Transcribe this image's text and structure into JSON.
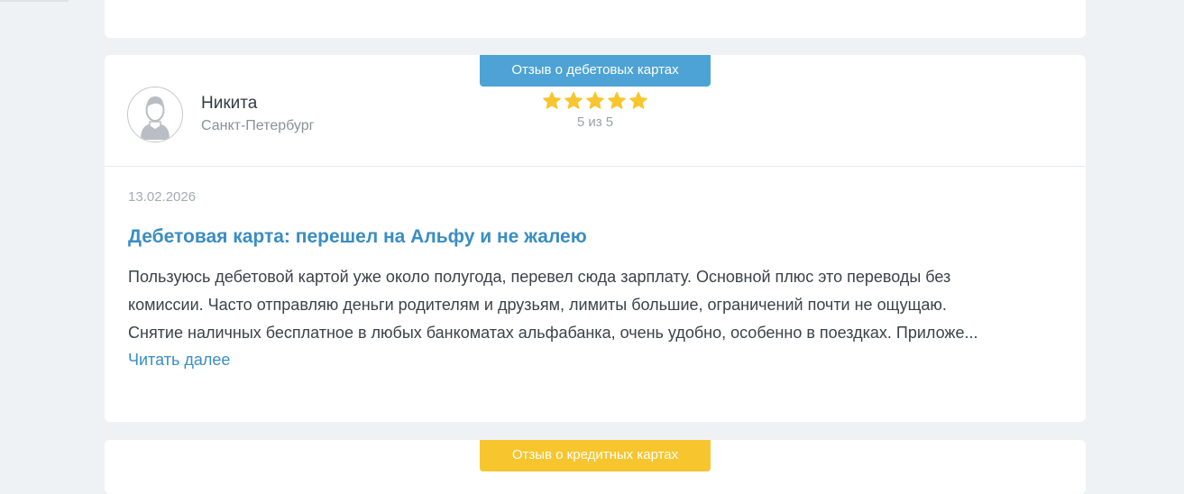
{
  "reviews": [
    {
      "badge": "Отзыв о дебетовых картах",
      "badge_color": "#4da3d6",
      "author_name": "Никита",
      "author_city": "Санкт-Петербург",
      "rating": 5,
      "rating_text": "5 из 5",
      "date": "13.02.2026",
      "title": "Дебетовая карта: перешел на Альфу и не жалею",
      "text_lines": [
        "Пользуюсь дебетовой картой уже около полугода, перевел сюда зарплату. Основной плюс это переводы без",
        "комиссии. Часто отправляю деньги родителям и друзьям, лимиты большие, ограничений почти не ощущаю.",
        "Снятие наличных бесплатное в любых банкоматах альфабанка, очень удобно, особенно в поездках. Приложе..."
      ],
      "read_more": "Читать далее"
    },
    {
      "badge": "Отзыв о кредитных картах",
      "badge_color": "#f7c52e"
    }
  ],
  "icons": {
    "avatar": "user-avatar-icon",
    "star": "star-icon",
    "star_color": "#f7c52e"
  }
}
